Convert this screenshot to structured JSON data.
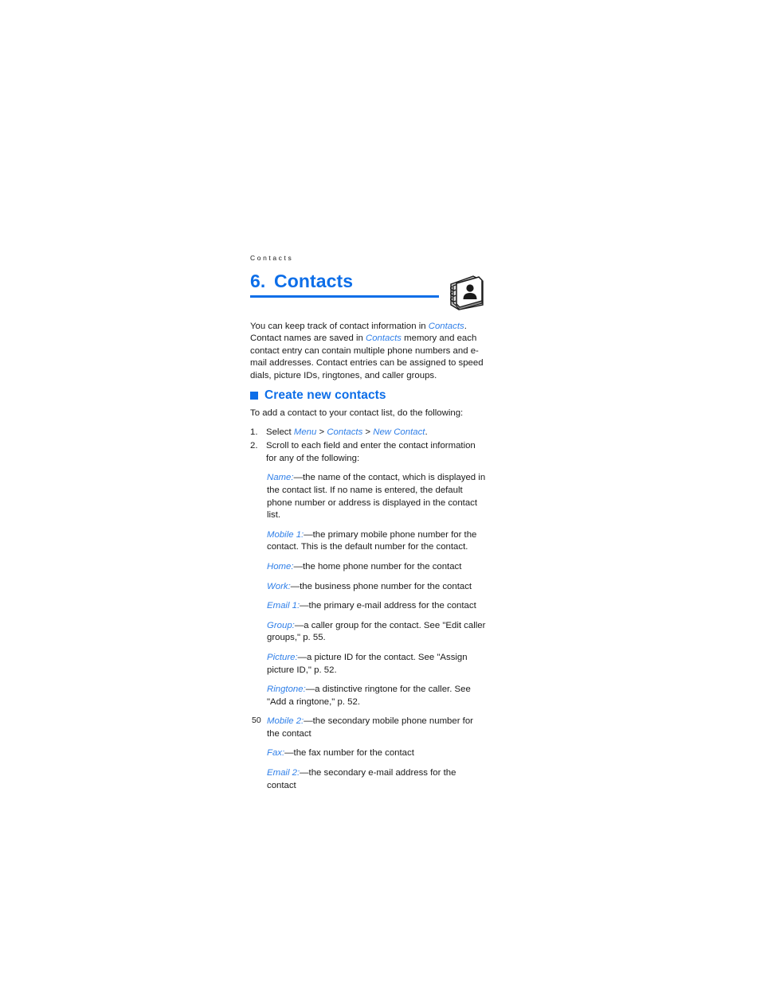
{
  "document": {
    "running_header": "Contacts",
    "page_number": "50",
    "accent_color": "#0d6ee8",
    "link_color": "#2f7fe8",
    "body_color": "#1a1a1a"
  },
  "chapter": {
    "number": "6.",
    "title": "Contacts",
    "icon": "address-book-icon"
  },
  "intro": {
    "part1": "You can keep track of contact information in ",
    "term1": "Contacts",
    "part2": ". Contact names are saved in ",
    "term2": "Contacts",
    "part3": " memory and each contact entry can contain multiple phone numbers and e-mail addresses. Contact entries can be assigned to speed dials, picture IDs, ringtones, and caller groups."
  },
  "section": {
    "heading": "Create new contacts",
    "lead": "To add a contact to your contact list, do the following:",
    "steps": [
      {
        "number": "1.",
        "prefix": "Select ",
        "menu_path": [
          "Menu",
          "Contacts",
          "New Contact"
        ],
        "separator": " > ",
        "suffix": "."
      },
      {
        "number": "2.",
        "text": "Scroll to each field and enter the contact information for any of the following:"
      }
    ],
    "fields": [
      {
        "label": "Name:",
        "description": "—the name of the contact, which is displayed in the contact list. If no name is entered, the default phone number or address is displayed in the contact list."
      },
      {
        "label": "Mobile 1:",
        "description": "—the primary mobile phone number for the contact. This is the default number for the contact."
      },
      {
        "label": "Home:",
        "description": "—the home phone number for the contact"
      },
      {
        "label": "Work:",
        "description": "—the business phone number for the contact"
      },
      {
        "label": "Email 1:",
        "description": "—the primary e-mail address for the contact"
      },
      {
        "label": "Group:",
        "description": "—a caller group for the contact. See \"Edit caller groups,\" p. 55."
      },
      {
        "label": "Picture:",
        "description": "—a picture ID for the contact. See \"Assign picture ID,\" p. 52."
      },
      {
        "label": "Ringtone:",
        "description": "—a distinctive ringtone for the caller. See \"Add a ringtone,\" p. 52."
      },
      {
        "label": "Mobile 2:",
        "description": "—the secondary mobile phone number for the contact"
      },
      {
        "label": "Fax:",
        "description": "—the fax number for the contact"
      },
      {
        "label": "Email 2:",
        "description": "—the secondary e-mail address for the contact"
      }
    ]
  }
}
